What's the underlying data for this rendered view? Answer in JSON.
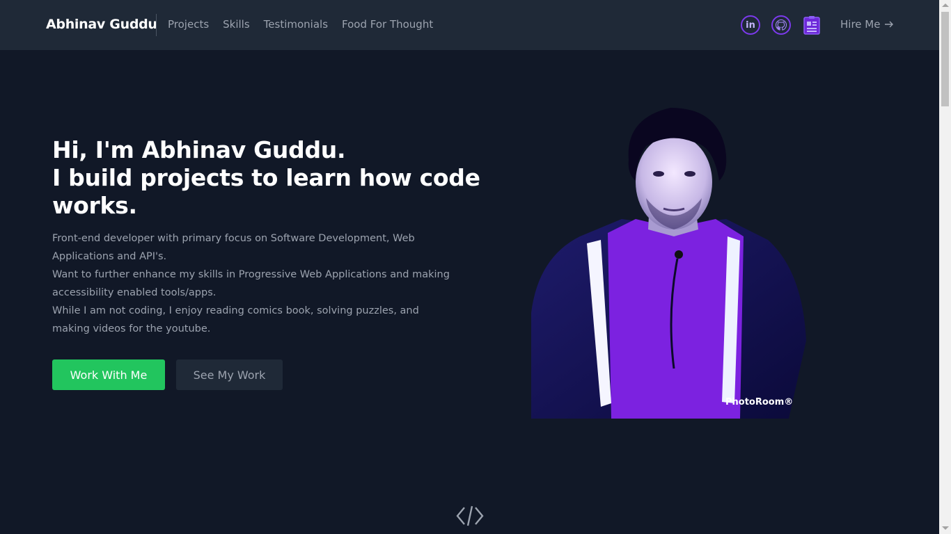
{
  "header": {
    "brand": "Abhinav Guddu",
    "nav": [
      {
        "label": "Projects"
      },
      {
        "label": "Skills"
      },
      {
        "label": "Testimonials"
      },
      {
        "label": "Food For Thought"
      }
    ],
    "social": [
      {
        "icon": "linkedin-icon",
        "text": "in"
      },
      {
        "icon": "github-icon"
      },
      {
        "icon": "resume-icon"
      }
    ],
    "hire_label": "Hire Me",
    "hire_icon": "arrow-right-icon"
  },
  "hero": {
    "headline_line1": "Hi, I'm Abhinav Guddu.",
    "headline_line2": "I build projects to learn how code works.",
    "bio": [
      "Front-end developer with primary focus on Software Development, Web Applications and API's.",
      "Want to further enhance my skills in Progressive Web Applications and making accessibility enabled tools/apps.",
      "While I am not coding, I enjoy reading comics book, solving puzzles, and making videos for the youtube."
    ],
    "primary_button": "Work With Me",
    "secondary_button": "See My Work",
    "photo_watermark": "PhotoRoom®"
  },
  "footer_icon": "code-icon",
  "colors": {
    "background": "#111827",
    "header": "#1f2937",
    "accent_green": "#22c55e",
    "accent_purple": "#7c3aed"
  }
}
